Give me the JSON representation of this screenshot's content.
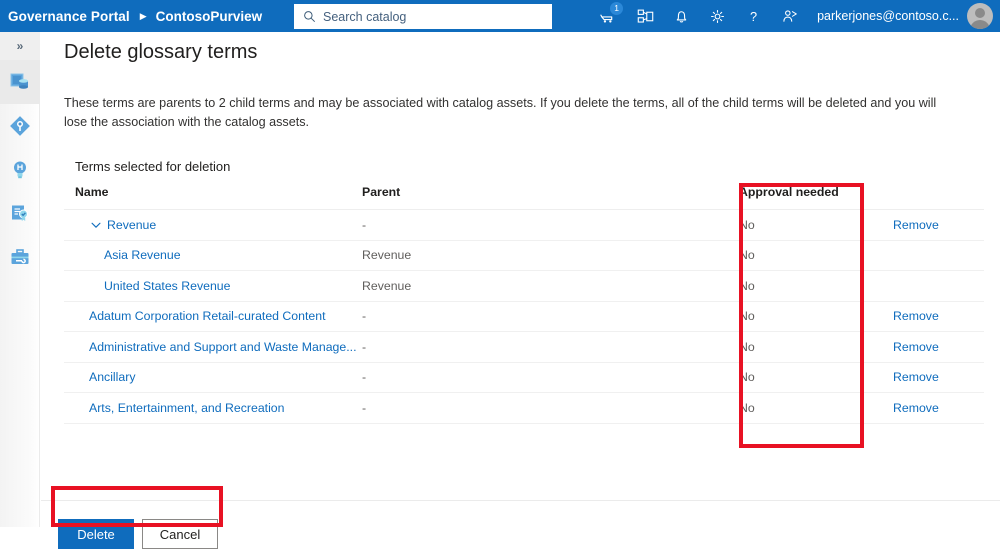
{
  "header": {
    "brand_portal": "Governance Portal",
    "brand_separator": "▶",
    "brand_account": "ContosoPurview",
    "search": {
      "placeholder": "Search catalog",
      "value": "",
      "icon": "search-icon"
    },
    "icons": [
      {
        "name": "scan-cart-icon",
        "badge": "1"
      },
      {
        "name": "workflow-icon",
        "badge": ""
      },
      {
        "name": "bell-icon",
        "badge": ""
      },
      {
        "name": "gear-icon",
        "badge": ""
      },
      {
        "name": "help-icon",
        "badge": ""
      },
      {
        "name": "feedback-icon",
        "badge": ""
      }
    ],
    "username": "parkerjones@contoso.c...",
    "avatar": "avatar"
  },
  "sidebar": {
    "expand_label": "»",
    "items": [
      {
        "name": "sidebar-item-data-sources",
        "icon": "data-sources-icon",
        "selected": true
      },
      {
        "name": "sidebar-item-data-map",
        "icon": "data-map-icon",
        "selected": false
      },
      {
        "name": "sidebar-item-insights",
        "icon": "insights-bulb-icon",
        "selected": false
      },
      {
        "name": "sidebar-item-glossary",
        "icon": "glossary-certificate-icon",
        "selected": false
      },
      {
        "name": "sidebar-item-management",
        "icon": "management-toolbox-icon",
        "selected": false
      }
    ]
  },
  "main": {
    "title": "Delete glossary terms",
    "description": "These terms are parents to 2 child terms and may be associated with catalog assets. If you delete the terms, all of the child terms will be deleted and you will lose the association with the catalog assets.",
    "table_caption": "Terms selected for deletion",
    "columns": [
      "Name",
      "Parent",
      "Approval needed",
      ""
    ],
    "rows": [
      {
        "name": "Revenue",
        "parent": "-",
        "approval": "No",
        "action": "Remove",
        "indent": 0,
        "expander": "chevron-down-icon"
      },
      {
        "name": "Asia Revenue",
        "parent": "Revenue",
        "approval": "No",
        "action": "",
        "indent": 1,
        "expander": ""
      },
      {
        "name": "United States Revenue",
        "parent": "Revenue",
        "approval": "No",
        "action": "",
        "indent": 1,
        "expander": ""
      },
      {
        "name": "Adatum Corporation Retail-curated Content",
        "parent": "-",
        "approval": "No",
        "action": "Remove",
        "indent": 0,
        "expander": ""
      },
      {
        "name": "Administrative and Support and Waste Manage...",
        "parent": "-",
        "approval": "No",
        "action": "Remove",
        "indent": 0,
        "expander": ""
      },
      {
        "name": "Ancillary",
        "parent": "-",
        "approval": "No",
        "action": "Remove",
        "indent": 0,
        "expander": ""
      },
      {
        "name": "Arts, Entertainment, and Recreation",
        "parent": "-",
        "approval": "No",
        "action": "Remove",
        "indent": 0,
        "expander": ""
      }
    ]
  },
  "footer": {
    "delete_label": "Delete",
    "cancel_label": "Cancel"
  },
  "annotations": {
    "color": "#e81123",
    "boxes": [
      "approval-needed-column",
      "footer-buttons"
    ]
  }
}
